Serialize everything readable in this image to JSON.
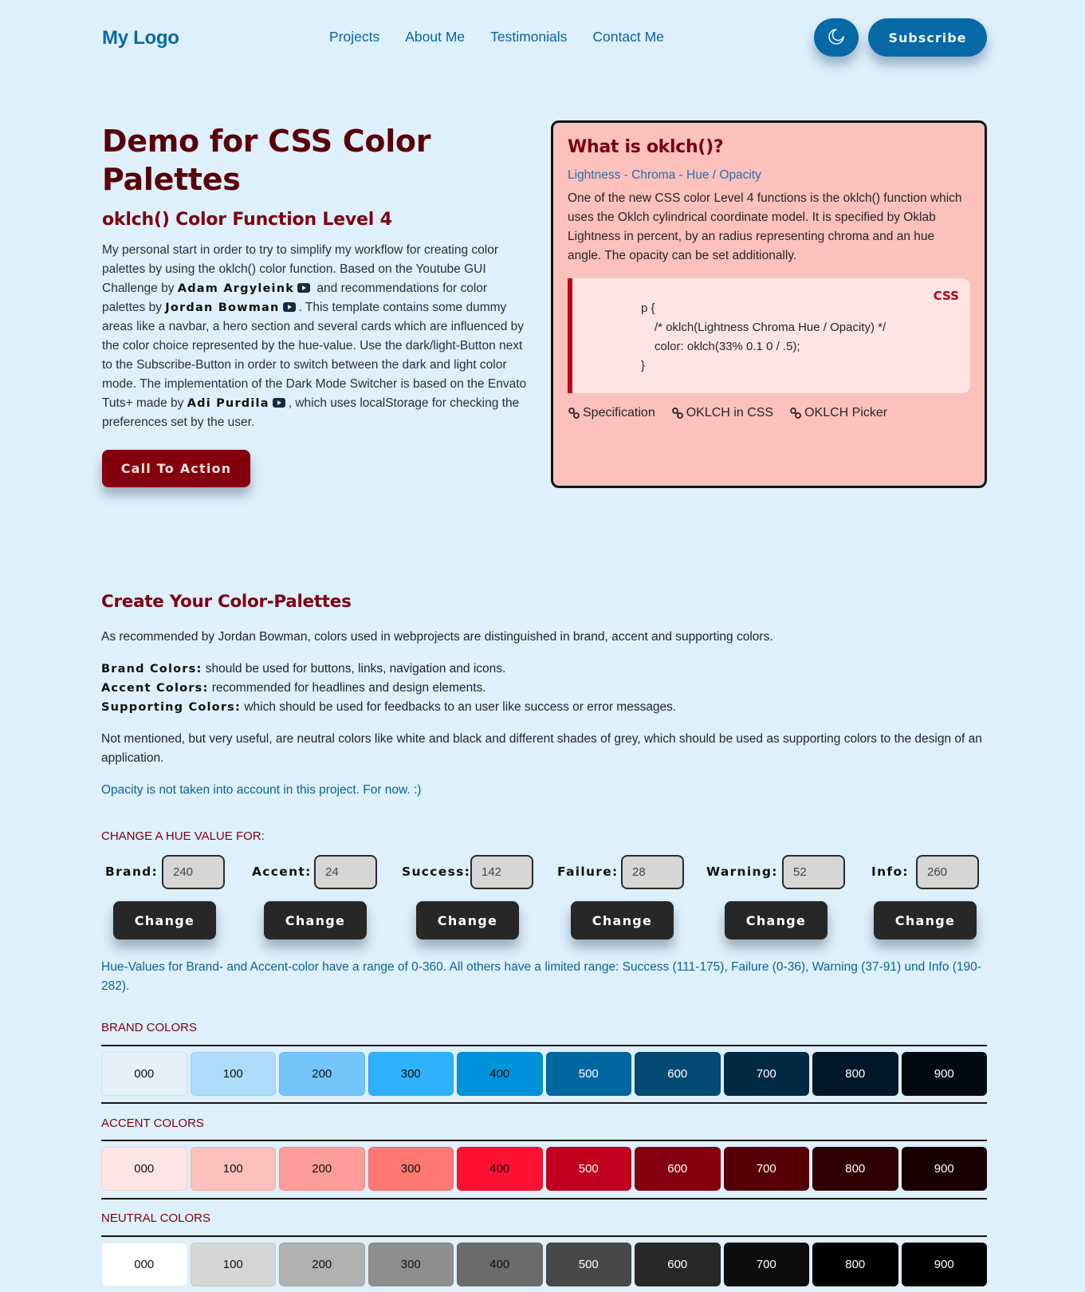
{
  "nav": {
    "logo": "My Logo",
    "links": [
      "Projects",
      "About Me",
      "Testimonials",
      "Contact Me"
    ],
    "theme_icon": "moon-icon",
    "subscribe_label": "Subscribe"
  },
  "hero": {
    "title": "Demo for CSS Color Palettes",
    "subtitle": "oklch() Color Function Level 4",
    "paragraph": {
      "t1": "My personal start in order to try to simplify my workflow for creating color palettes by using the oklch() color function. Based on the Youtube GUI Challenge by ",
      "name1": "Adam Argyleink",
      "t2": " and recommendations for color palettes by ",
      "name2": "Jordan Bowman",
      "t3": ". This template contains some dummy areas like a navbar, a hero section and several cards which are influenced by the color choice represented by the hue-value. Use the dark/light-Button next to the Subscribe-Button in order to switch between the dark and light color mode. The implementation of the Dark Mode Switcher is based on the Envato Tuts+ made by ",
      "name3": "Adi Purdila",
      "t4": ", which uses localStorage for checking the preferences set by the user."
    },
    "cta_label": "Call To Action"
  },
  "card": {
    "title": "What is oklch()?",
    "subtitle": "Lightness - Chroma - Hue / Opacity",
    "text": "One of the new CSS color Level 4 functions is the oklch() function which uses the Oklch cylindrical coordinate model. It is specified by Oklab Lightness in percent, by an radius representing chroma and an hue angle. The opacity can be set additionally.",
    "code_lang": "CSS",
    "code_lines": [
      "p {",
      "/* oklch(Lightness Chroma Hue / Opacity) */",
      "color: oklch(33% 0.1 0 / .5);",
      "}"
    ],
    "links": [
      "Specification",
      "OKLCH in CSS",
      "OKLCH Picker"
    ]
  },
  "palettes_section": {
    "title": "Create Your Color-Palettes",
    "intro": "As recommended by Jordan Bowman, colors used in webprojects are distinguished in brand, accent and supporting colors.",
    "definitions": [
      {
        "term": "Brand Colors:",
        "text": " should be used for buttons, links, navigation and icons."
      },
      {
        "term": "Accent Colors:",
        "text": " recommended for headlines and design elements."
      },
      {
        "term": "Supporting Colors:",
        "text": " which should be used for feedbacks to an user like success or error messages."
      }
    ],
    "neutral_note": "Not mentioned, but very useful, are neutral colors like white and black and different shades of grey, which should be used as supporting colors to the design of an application.",
    "opacity_note": "Opacity is not taken into account in this project. For now. :)",
    "hue_heading": "CHANGE A HUE VALUE FOR:",
    "hue_controls": [
      {
        "label": "Brand:",
        "value": "240",
        "button": "Change"
      },
      {
        "label": "Accent:",
        "value": "24",
        "button": "Change"
      },
      {
        "label": "Success:",
        "value": "142",
        "button": "Change"
      },
      {
        "label": "Failure:",
        "value": "28",
        "button": "Change"
      },
      {
        "label": "Warning:",
        "value": "52",
        "button": "Change"
      },
      {
        "label": "Info:",
        "value": "260",
        "button": "Change"
      }
    ],
    "range_note": "Hue-Values for Brand- and Accent-color have a range of 0-360. All others have a limited range: Success (111-175), Failure (0-36), Warning (37-91) und Info (190-282).",
    "palettes": [
      {
        "label": "BRAND COLORS",
        "swatches": [
          {
            "name": "000",
            "bg": "#e4f1fb",
            "fg": "#111111"
          },
          {
            "name": "100",
            "bg": "#addcfb",
            "fg": "#111111"
          },
          {
            "name": "200",
            "bg": "#73c4fa",
            "fg": "#111111"
          },
          {
            "name": "300",
            "bg": "#2fb2fb",
            "fg": "#111111"
          },
          {
            "name": "400",
            "bg": "#0092db",
            "fg": "#111111"
          },
          {
            "name": "500",
            "bg": "#0167a1",
            "fg": "#ffffff"
          },
          {
            "name": "600",
            "bg": "#034a74",
            "fg": "#ffffff"
          },
          {
            "name": "700",
            "bg": "#022a45",
            "fg": "#ffffff"
          },
          {
            "name": "800",
            "bg": "#011729",
            "fg": "#ffffff"
          },
          {
            "name": "900",
            "bg": "#010a13",
            "fg": "#ffffff"
          }
        ]
      },
      {
        "label": "ACCENT COLORS",
        "swatches": [
          {
            "name": "000",
            "bg": "#fde5e4",
            "fg": "#111111"
          },
          {
            "name": "100",
            "bg": "#fdc1bd",
            "fg": "#111111"
          },
          {
            "name": "200",
            "bg": "#fc9d99",
            "fg": "#111111"
          },
          {
            "name": "300",
            "bg": "#fd7872",
            "fg": "#111111"
          },
          {
            "name": "400",
            "bg": "#ff1133",
            "fg": "#111111"
          },
          {
            "name": "500",
            "bg": "#c0001f",
            "fg": "#ffffff"
          },
          {
            "name": "600",
            "bg": "#840010",
            "fg": "#ffffff"
          },
          {
            "name": "700",
            "bg": "#560006",
            "fg": "#ffffff"
          },
          {
            "name": "800",
            "bg": "#2f0003",
            "fg": "#ffffff"
          },
          {
            "name": "900",
            "bg": "#190001",
            "fg": "#ffffff"
          }
        ]
      },
      {
        "label": "NEUTRAL COLORS",
        "swatches": [
          {
            "name": "000",
            "bg": "#ffffff",
            "fg": "#111111"
          },
          {
            "name": "100",
            "bg": "#d6d6d6",
            "fg": "#111111"
          },
          {
            "name": "200",
            "bg": "#b1b1b1",
            "fg": "#111111"
          },
          {
            "name": "300",
            "bg": "#8e8e8e",
            "fg": "#111111"
          },
          {
            "name": "400",
            "bg": "#6b6b6b",
            "fg": "#111111"
          },
          {
            "name": "500",
            "bg": "#484848",
            "fg": "#ffffff"
          },
          {
            "name": "600",
            "bg": "#282828",
            "fg": "#ffffff"
          },
          {
            "name": "700",
            "bg": "#0d0d0d",
            "fg": "#ffffff"
          },
          {
            "name": "800",
            "bg": "#000000",
            "fg": "#ffffff"
          },
          {
            "name": "900",
            "bg": "#000000",
            "fg": "#ffffff"
          }
        ]
      }
    ]
  },
  "colors": {
    "background": "#ddf0fc",
    "brand": "#0769a5",
    "accent": "#85000f",
    "card_bg": "#fdc1bd"
  }
}
